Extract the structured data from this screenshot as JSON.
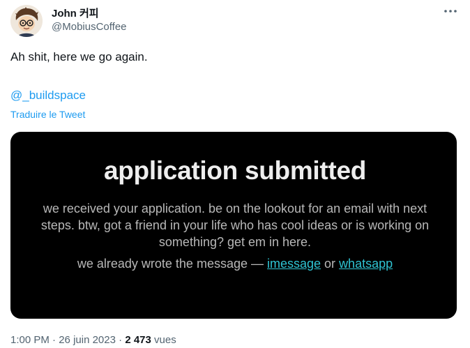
{
  "author": {
    "name": "John 커피",
    "handle": "@MobiusCoffee"
  },
  "tweet": {
    "text": "Ah shit, here we go again.",
    "mention": "@_buildspace",
    "translate_label": "Traduire le Tweet"
  },
  "media": {
    "title": "application submitted",
    "body": "we received your application. be on the lookout for an email with next steps. btw, got a friend in your life who has cool ideas or is working on something? get em in here.",
    "cta_prefix": "we already wrote the message — ",
    "link_imessage": "imessage",
    "cta_or": " or ",
    "link_whatsapp": "whatsapp"
  },
  "meta": {
    "time": "1:00 PM",
    "separator": " · ",
    "date": "26 juin 2023",
    "views_count": "2 473",
    "views_label": " vues"
  },
  "colors": {
    "accent": "#1d9bf0",
    "link_teal": "#2fc4d3",
    "muted": "#536471"
  },
  "icons": {
    "more": "more-options-icon",
    "avatar": "cartoon-avatar"
  }
}
